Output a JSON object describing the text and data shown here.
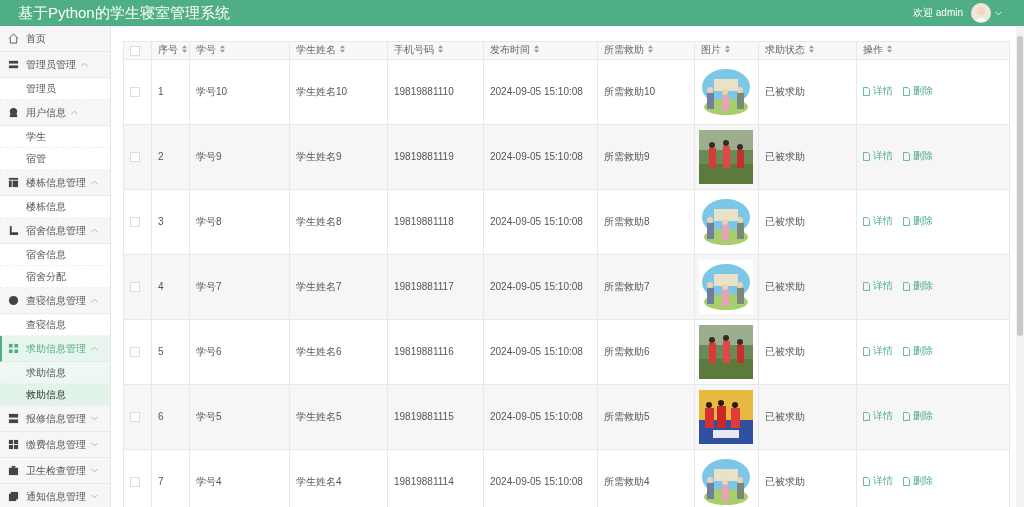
{
  "header": {
    "title": "基于Python的学生寝室管理系统",
    "welcome": "欢迎 admin"
  },
  "sidebar": {
    "items": [
      {
        "kind": "link",
        "label": "首页",
        "selected": false
      },
      {
        "kind": "group",
        "label": "管理员管理",
        "expanded": true,
        "selected": false,
        "children": [
          {
            "label": "管理员",
            "selected": false
          }
        ]
      },
      {
        "kind": "group",
        "label": "用户信息",
        "expanded": true,
        "selected": false,
        "children": [
          {
            "label": "学生",
            "selected": false
          },
          {
            "label": "宿管",
            "selected": false
          }
        ]
      },
      {
        "kind": "group",
        "label": "楼栋信息管理",
        "expanded": true,
        "selected": false,
        "children": [
          {
            "label": "楼栋信息",
            "selected": false
          }
        ]
      },
      {
        "kind": "group",
        "label": "宿舍信息管理",
        "expanded": true,
        "selected": false,
        "children": [
          {
            "label": "宿舍信息",
            "selected": false
          },
          {
            "label": "宿舍分配",
            "selected": false
          }
        ]
      },
      {
        "kind": "group",
        "label": "查寝信息管理",
        "expanded": true,
        "selected": false,
        "children": [
          {
            "label": "查寝信息",
            "selected": false
          }
        ]
      },
      {
        "kind": "group",
        "label": "求助信息管理",
        "expanded": true,
        "selected": true,
        "children": [
          {
            "label": "求助信息",
            "selected": false
          },
          {
            "label": "救助信息",
            "selected": true
          }
        ]
      },
      {
        "kind": "group",
        "label": "报修信息管理",
        "expanded": false,
        "selected": false
      },
      {
        "kind": "group",
        "label": "缴费信息管理",
        "expanded": false,
        "selected": false
      },
      {
        "kind": "group",
        "label": "卫生检查管理",
        "expanded": false,
        "selected": false
      },
      {
        "kind": "group",
        "label": "通知信息管理",
        "expanded": false,
        "selected": false
      }
    ]
  },
  "table": {
    "select_all": {
      "checked": false
    },
    "columns": [
      "序号",
      "学号",
      "学生姓名",
      "手机号码",
      "发布时间",
      "所需救助",
      "图片",
      "求助状态",
      "操作"
    ],
    "rows": [
      {
        "checked": false,
        "cells": [
          "1",
          "学号10",
          "学生姓名10",
          "19819881110",
          "2024-09-05 15:10:08",
          "所需救助10"
        ],
        "image": {
          "kind": "picture"
        },
        "status": "已被求助",
        "actions": [
          "详情",
          "删除"
        ]
      },
      {
        "checked": false,
        "cells": [
          "2",
          "学号9",
          "学生姓名9",
          "19819881119",
          "2024-09-05 15:10:08",
          "所需救助9"
        ],
        "image": {
          "kind": "picture"
        },
        "status": "已被求助",
        "actions": [
          "详情",
          "删除"
        ]
      },
      {
        "checked": false,
        "cells": [
          "3",
          "学号8",
          "学生姓名8",
          "19819881118",
          "2024-09-05 15:10:08",
          "所需救助8"
        ],
        "image": {
          "kind": "picture"
        },
        "status": "已被求助",
        "actions": [
          "详情",
          "删除"
        ]
      },
      {
        "checked": false,
        "cells": [
          "4",
          "学号7",
          "学生姓名7",
          "19819881117",
          "2024-09-05 15:10:08",
          "所需救助7"
        ],
        "image": {
          "kind": "picture"
        },
        "status": "已被求助",
        "actions": [
          "详情",
          "删除"
        ]
      },
      {
        "checked": false,
        "cells": [
          "5",
          "学号6",
          "学生姓名6",
          "19819881116",
          "2024-09-05 15:10:08",
          "所需救助6"
        ],
        "image": {
          "kind": "picture"
        },
        "status": "已被求助",
        "actions": [
          "详情",
          "删除"
        ]
      },
      {
        "checked": false,
        "cells": [
          "6",
          "学号5",
          "学生姓名5",
          "19819881115",
          "2024-09-05 15:10:08",
          "所需救助5"
        ],
        "image": {
          "kind": "picture"
        },
        "status": "已被求助",
        "actions": [
          "详情",
          "删除"
        ]
      },
      {
        "checked": false,
        "cells": [
          "7",
          "学号4",
          "学生姓名4",
          "19819881114",
          "2024-09-05 15:10:08",
          "所需救助4"
        ],
        "image": {
          "kind": "picture"
        },
        "status": "已被求助",
        "actions": [
          "详情",
          "删除"
        ]
      }
    ]
  }
}
